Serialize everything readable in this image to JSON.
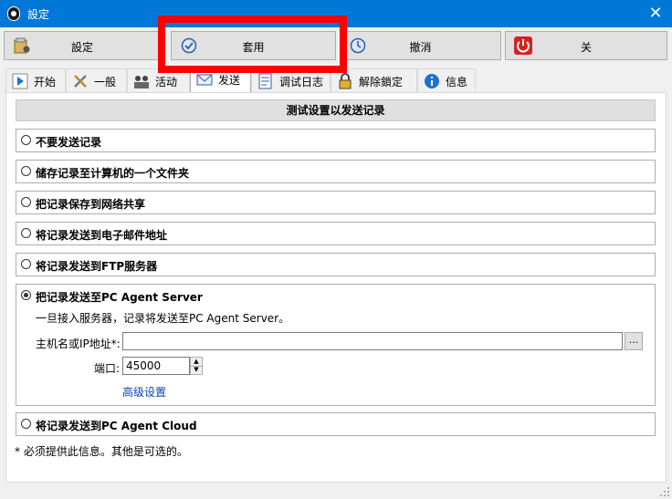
{
  "window": {
    "title": "設定",
    "close_glyph": "✕"
  },
  "toolbar": [
    {
      "label": "設定",
      "icon": "settings-folder-icon"
    },
    {
      "label": "套用",
      "icon": "apply-clock-icon"
    },
    {
      "label": "撤消",
      "icon": "undo-clock-icon"
    },
    {
      "label": "关",
      "icon": "power-icon"
    }
  ],
  "tabs": [
    {
      "label": "开始",
      "icon": "play-icon"
    },
    {
      "label": "一般",
      "icon": "tools-icon"
    },
    {
      "label": "活动",
      "icon": "people-icon"
    },
    {
      "label": "发送",
      "icon": "send-mail-icon",
      "active": true
    },
    {
      "label": "调试日志",
      "icon": "log-icon"
    },
    {
      "label": "解除鎖定",
      "icon": "lock-icon"
    },
    {
      "label": "信息",
      "icon": "info-icon"
    }
  ],
  "section_title": "测试设置以发送记录",
  "options": [
    {
      "label": "不要发送记录",
      "checked": false
    },
    {
      "label": "储存记录至计算机的一个文件夹",
      "checked": false
    },
    {
      "label": "把记录保存到网络共享",
      "checked": false
    },
    {
      "label": "将记录发送到电子邮件地址",
      "checked": false
    },
    {
      "label": "将记录发送到FTP服务器",
      "checked": false
    },
    {
      "label": "把记录发送至PC Agent Server",
      "checked": true
    },
    {
      "label": "将记录发送到PC Agent Cloud",
      "checked": false
    }
  ],
  "server": {
    "description": "一旦接入服务器，记录将发送至PC Agent Server。",
    "host_label": "主机名或IP地址*:",
    "host_value": "",
    "browse_label": "...",
    "port_label": "端口:",
    "port_value": "45000",
    "advanced_link": "高级设置"
  },
  "footnote": "* 必须提供此信息。其他是可选的。",
  "colors": {
    "titlebar": "#0078d7",
    "highlight_box": "#ff0000",
    "link": "#0645ad"
  }
}
